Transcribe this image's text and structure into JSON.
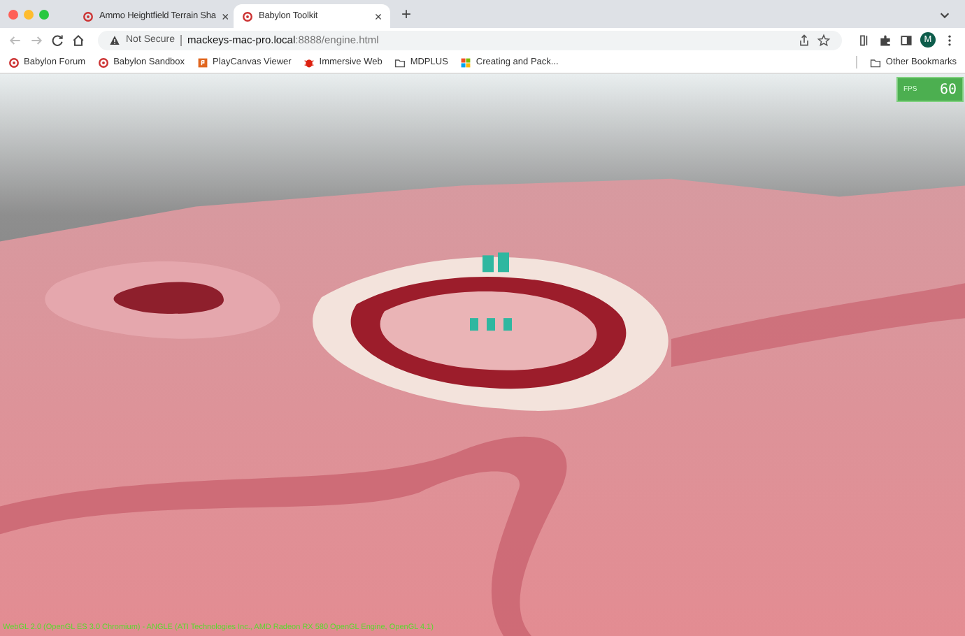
{
  "tabs": [
    {
      "title": "Ammo Heightfield Terrain Sha",
      "selected": false,
      "close": "×"
    },
    {
      "title": "Babylon Toolkit",
      "selected": true,
      "close": "×"
    }
  ],
  "new_tab": "+",
  "address_bar": {
    "security": "Not Secure",
    "host": "mackeys-mac-pro.local",
    "path": ":8888/engine.html"
  },
  "profile": {
    "initial": "M"
  },
  "bookmarks": [
    {
      "label": "Babylon Forum",
      "kind": "babylon"
    },
    {
      "label": "Babylon Sandbox",
      "kind": "babylon"
    },
    {
      "label": "PlayCanvas Viewer",
      "kind": "playcanvas"
    },
    {
      "label": "Immersive Web",
      "kind": "bug"
    },
    {
      "label": "MDPLUS",
      "kind": "folder"
    },
    {
      "label": "Creating and Pack...",
      "kind": "windows"
    }
  ],
  "other_bookmarks": "Other Bookmarks",
  "fps_meter": {
    "label": "FPS",
    "value": "60"
  },
  "renderer_info": "WebGL 2.0 (OpenGL ES 3.0 Chromium) - ANGLE (ATI Technologies Inc., AMD Radeon RX 580 OpenGL Engine, OpenGL 4.1)"
}
